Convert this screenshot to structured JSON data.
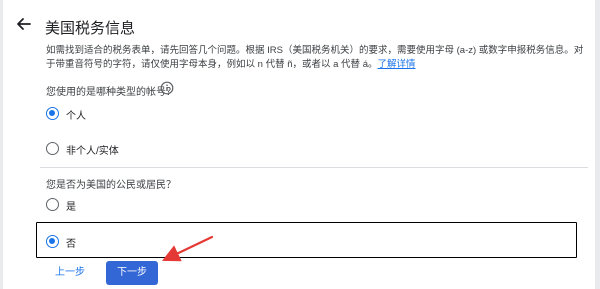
{
  "header": {
    "title": "美国税务信息"
  },
  "intro": {
    "text": "如需找到适合的税务表单，请先回答几个问题。根据 IRS（美国税务机关）的要求，需要使用字母 (a-z) 或数字申报税务信息。对于带重音符号的字符，请仅使用字母本身，例如以 n 代替 ñ，或者以 a 代替 á。",
    "link": "了解详情"
  },
  "account_question": {
    "label": "您使用的是哪种类型的帐号？",
    "options": [
      {
        "label": "个人",
        "selected": true
      },
      {
        "label": "非个人/实体",
        "selected": false
      }
    ]
  },
  "citizen_question": {
    "label": "您是否为美国的公民或居民？",
    "options": [
      {
        "label": "是",
        "selected": false
      },
      {
        "label": "否",
        "selected": true
      }
    ]
  },
  "buttons": {
    "prev": "上一步",
    "next": "下一步"
  },
  "colors": {
    "accent": "#1a73e8",
    "primary_button": "#3367d6",
    "annotation_arrow": "#e53935",
    "annotation_box": "#000000"
  },
  "icons": {
    "back": "arrow-left-icon",
    "help": "help-circle-icon"
  }
}
